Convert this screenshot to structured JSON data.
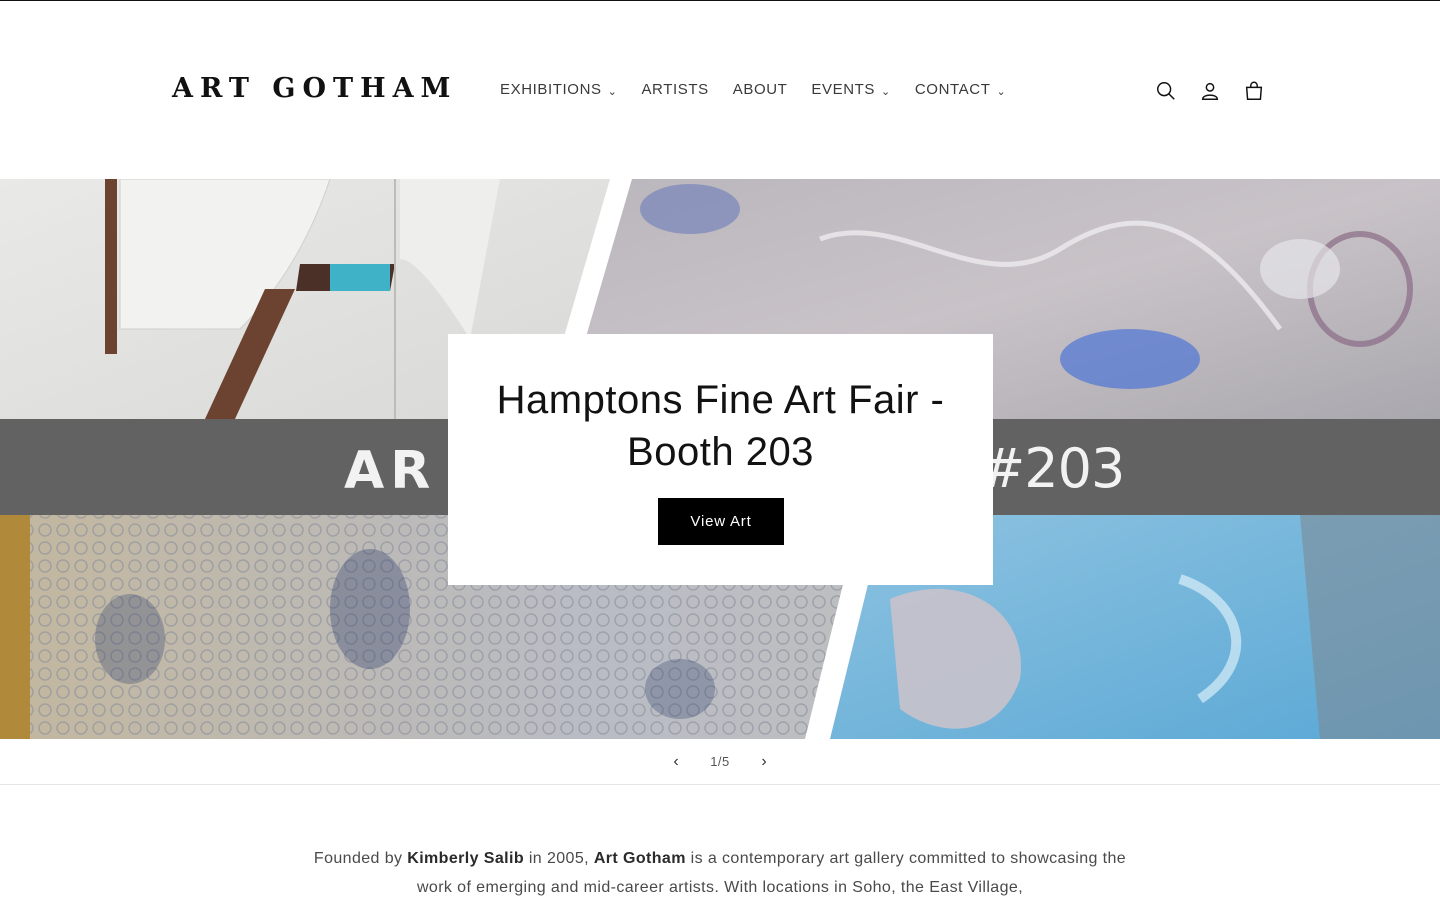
{
  "header": {
    "logo": "ART GOTHAM",
    "nav": [
      {
        "label": "EXHIBITIONS",
        "has_dropdown": true
      },
      {
        "label": "ARTISTS",
        "has_dropdown": false
      },
      {
        "label": "ABOUT",
        "has_dropdown": false
      },
      {
        "label": "EVENTS",
        "has_dropdown": true
      },
      {
        "label": "CONTACT",
        "has_dropdown": true
      }
    ],
    "icons": [
      "search-icon",
      "account-icon",
      "cart-icon"
    ]
  },
  "hero": {
    "title": "Hamptons Fine Art Fair - Booth 203",
    "button_label": "View Art",
    "band_text_left": "AR",
    "band_text_right": "#203"
  },
  "slider": {
    "counter": "1/5",
    "current": 1,
    "total": 5
  },
  "intro": {
    "prefix": "Founded by ",
    "founder": "Kimberly Salib",
    "mid1": " in 2005, ",
    "gallery": "Art Gotham",
    "mid2": " is a contemporary art gallery committed to showcasing the work of emerging and mid-career artists. With locations in Soho, the East Village,"
  },
  "colors": {
    "text": "#121212",
    "button_bg": "#000000",
    "band": "#585858"
  }
}
